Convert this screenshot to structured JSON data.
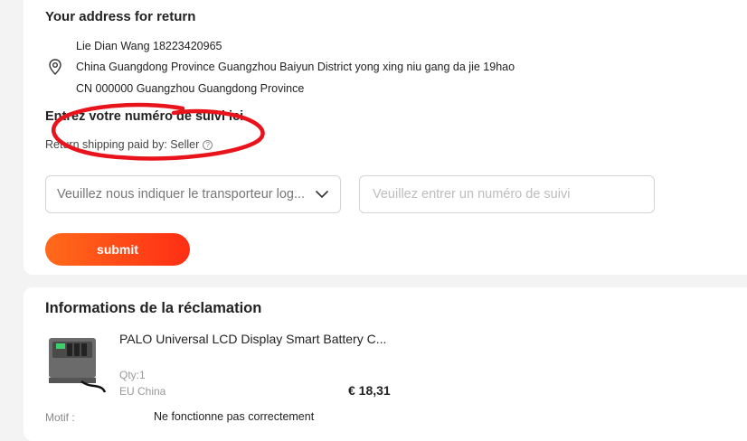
{
  "return_section": {
    "title": "Your address for return",
    "address": {
      "line1": "Lie Dian Wang 18223420965",
      "line2": "China Guangdong Province Guangzhou Baiyun District yong xing niu gang da jie 19hao",
      "line3": "CN 000000 Guangzhou Guangdong Province"
    },
    "tracking_title": "Entrez votre numéro de suivi ici",
    "shipping_note": "Return shipping paid by: Seller",
    "help_icon": "question-circle-icon",
    "carrier_select": {
      "value": "Veuillez nous indiquer le transporteur log..."
    },
    "tracking_input": {
      "placeholder": "Veuillez entrer un numéro de suivi"
    },
    "submit_label": "submit"
  },
  "claim_section": {
    "title": "Informations de la réclamation",
    "product": {
      "name": "PALO Universal LCD Display Smart Battery C...",
      "qty": "Qty:1",
      "origin": "EU China",
      "price": "€ 18,31"
    },
    "motif_label": "Motif :",
    "motif_value": "Ne fonctionne pas correctement"
  },
  "colors": {
    "accent_gradient_start": "#ff6a1a",
    "accent_gradient_end": "#ff2e14",
    "annotation_red": "#e8131b"
  }
}
